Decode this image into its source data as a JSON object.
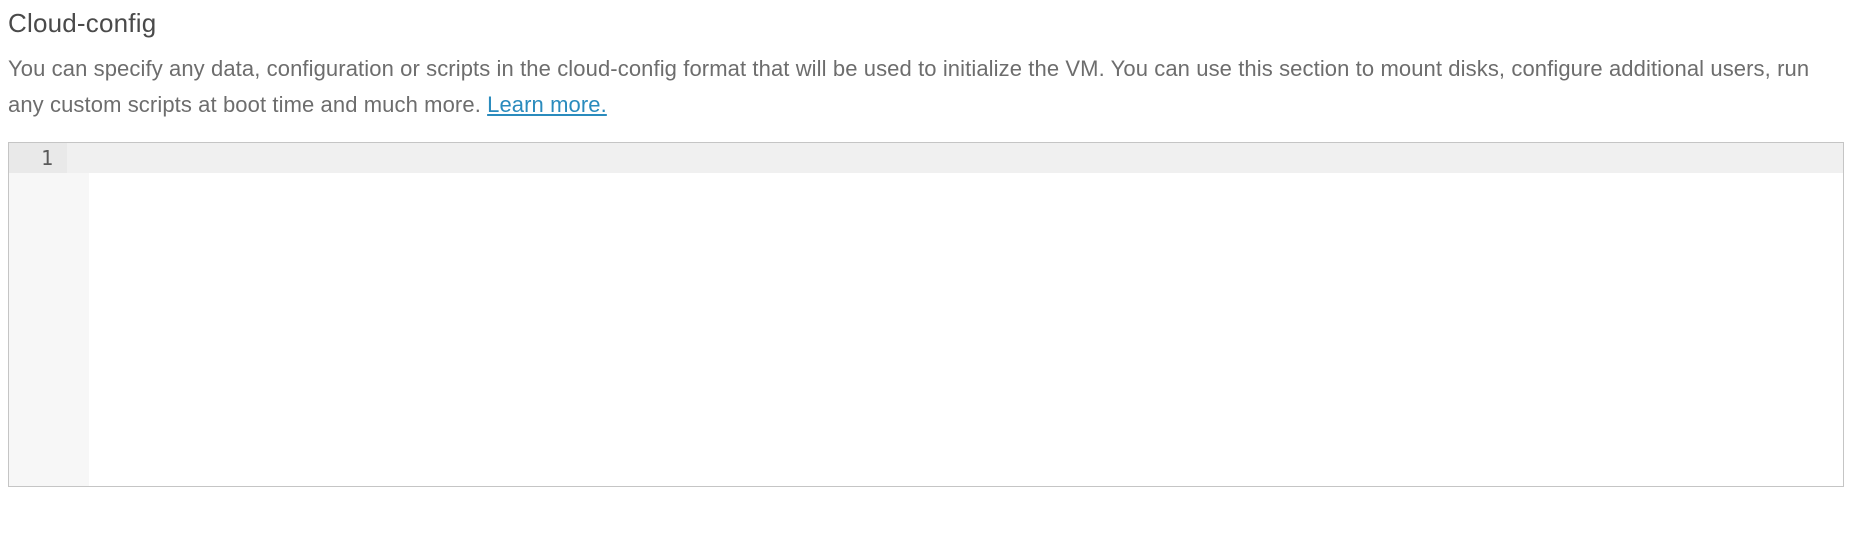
{
  "section": {
    "title": "Cloud-config",
    "description_prefix": "You can specify any data, configuration or scripts in the cloud-config format that will be used to initialize the VM. You can use this section to mount disks, configure additional users, run any custom scripts at boot time and much more. ",
    "learn_more_label": "Learn more."
  },
  "editor": {
    "line_number_1": "1",
    "content": ""
  }
}
